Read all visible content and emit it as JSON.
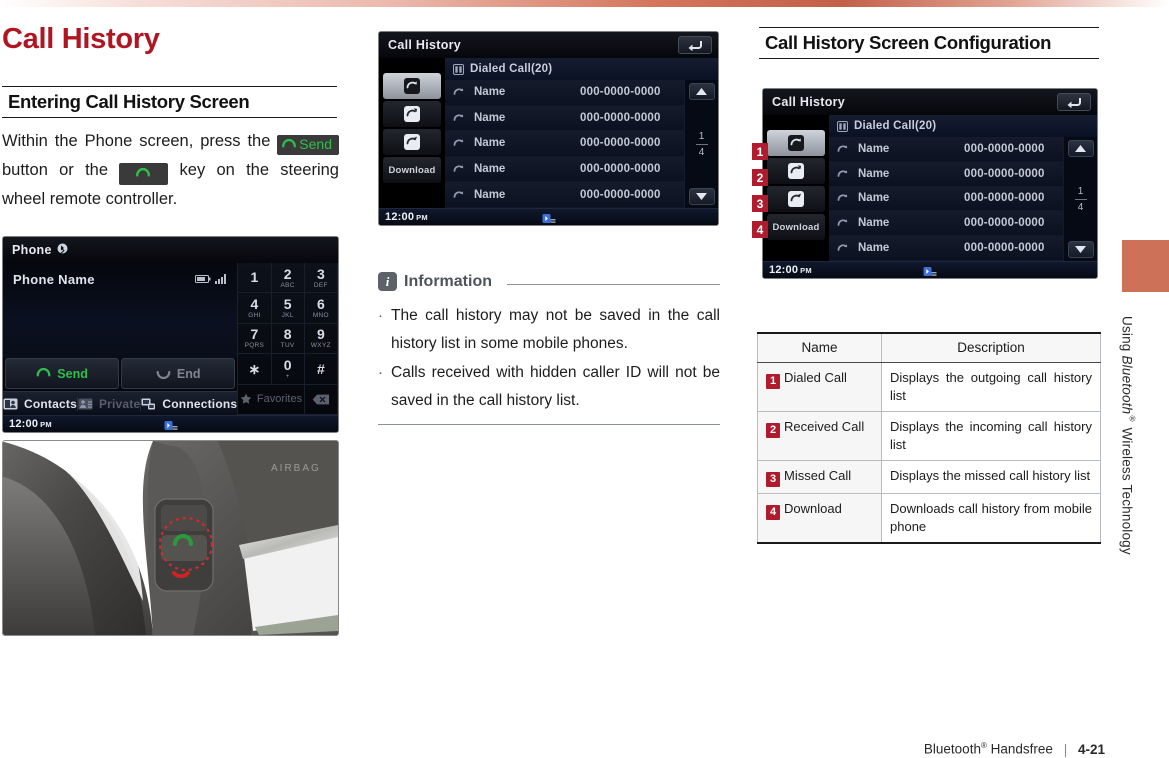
{
  "document": {
    "title": "Call History",
    "footer_brand": "Bluetooth",
    "footer_brand_sup": "®",
    "footer_label": "Handsfree",
    "footer_separator": "|",
    "footer_page": "4-21",
    "side_tab_prefix": "Using ",
    "side_tab_italic": "Bluetooth",
    "side_tab_sup": "®",
    "side_tab_suffix": " Wireless Technology"
  },
  "theme": {
    "title_red": "#b01622",
    "badge_red": "#b01c2e",
    "tab_salmon": "#cd7258",
    "screen_green": "#2fbf4a"
  },
  "left_column": {
    "section_heading": "Entering Call History Screen",
    "paragraph_part1": "Within the Phone screen, press the ",
    "send_key_label": "Send",
    "paragraph_part2": " button or the ",
    "paragraph_part3": " key on the steering wheel remote controller."
  },
  "phone_screen": {
    "title": "Phone",
    "phone_name": "Phone Name",
    "send_label": "Send",
    "end_label": "End",
    "keys": [
      {
        "num": "1",
        "sub": ""
      },
      {
        "num": "2",
        "sub": "ABC"
      },
      {
        "num": "3",
        "sub": "DEF"
      },
      {
        "num": "4",
        "sub": "GHI"
      },
      {
        "num": "5",
        "sub": "JKL"
      },
      {
        "num": "6",
        "sub": "MNO"
      },
      {
        "num": "7",
        "sub": "PQRS"
      },
      {
        "num": "8",
        "sub": "TUV"
      },
      {
        "num": "9",
        "sub": "WXYZ"
      },
      {
        "num": "∗",
        "sub": ""
      },
      {
        "num": "0",
        "sub": "+"
      },
      {
        "num": "#",
        "sub": ""
      }
    ],
    "favorites_label": "Favorites",
    "tabs": [
      {
        "label": "Contacts",
        "icon": "contacts-icon"
      },
      {
        "label": "Private",
        "icon": "private-icon"
      },
      {
        "label": "Connections",
        "icon": "connections-icon"
      }
    ],
    "clock": "12:00",
    "clock_ampm": "PM"
  },
  "call_history_screen": {
    "title": "Call History",
    "back_icon": "back-arrow-icon",
    "subtitle": "Dialed Call(20)",
    "side_buttons": [
      {
        "icon": "dialed-call-icon",
        "selected": true
      },
      {
        "icon": "received-call-icon",
        "selected": false
      },
      {
        "icon": "missed-call-icon",
        "selected": false
      }
    ],
    "download_label": "Download",
    "rows": [
      {
        "name": "Name",
        "phone": "000-0000-0000"
      },
      {
        "name": "Name",
        "phone": "000-0000-0000"
      },
      {
        "name": "Name",
        "phone": "000-0000-0000"
      },
      {
        "name": "Name",
        "phone": "000-0000-0000"
      },
      {
        "name": "Name",
        "phone": "000-0000-0000"
      }
    ],
    "page_current": "1",
    "page_total": "4",
    "clock": "12:00",
    "clock_ampm": "PM"
  },
  "information": {
    "heading": "Information",
    "icon": "info-icon",
    "bullets": [
      "The call history may not be saved in the call history list in some mobile phones.",
      "Calls received with hidden caller ID will not be saved in the call history list."
    ]
  },
  "right_column": {
    "section_heading": "Call History Screen Configuration",
    "callouts": [
      "1",
      "2",
      "3",
      "4"
    ],
    "table": {
      "headers": [
        "Name",
        "Description"
      ],
      "rows": [
        {
          "num": "1",
          "name": "Dialed Call",
          "description": "Displays the outgoing call history list"
        },
        {
          "num": "2",
          "name": "Received Call",
          "description": "Displays the incoming call history list"
        },
        {
          "num": "3",
          "name": "Missed Call",
          "description": "Displays the missed call history list"
        },
        {
          "num": "4",
          "name": "Download",
          "description": "Downloads call history from mobile phone"
        }
      ]
    }
  }
}
